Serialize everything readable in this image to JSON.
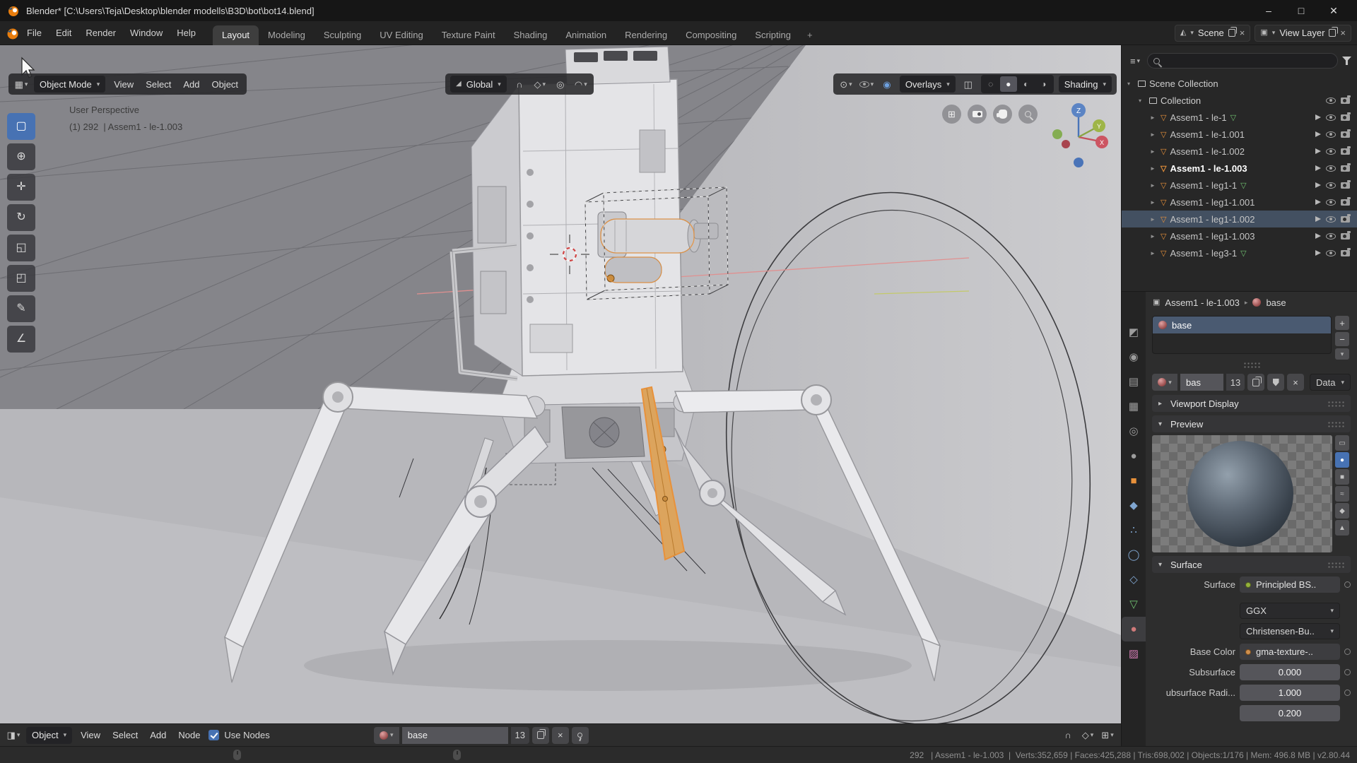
{
  "titlebar": {
    "title": "Blender* [C:\\Users\\Teja\\Desktop\\blender modells\\B3D\\bot\\bot14.blend]",
    "minimize": "–",
    "maximize": "□",
    "close": "✕"
  },
  "topbar": {
    "menus": [
      "File",
      "Edit",
      "Render",
      "Window",
      "Help"
    ],
    "tabs": [
      "Layout",
      "Modeling",
      "Sculpting",
      "UV Editing",
      "Texture Paint",
      "Shading",
      "Animation",
      "Rendering",
      "Compositing",
      "Scripting"
    ],
    "add_tab": "+",
    "scene_label": "Scene",
    "view_layer_label": "View Layer"
  },
  "viewport": {
    "mode": "Object Mode",
    "menu_view": "View",
    "menu_select": "Select",
    "menu_add": "Add",
    "menu_object": "Object",
    "orientation": "Global",
    "overlays_label": "Overlays",
    "shading_label": "Shading",
    "perspective_text": "User Perspective",
    "info_text": "(1) 292  | Assem1 - le-1.003",
    "gizmo": {
      "x": "X",
      "y": "Y",
      "z": "Z"
    }
  },
  "tools": [
    {
      "name": "select-box",
      "glyph": "▢"
    },
    {
      "name": "cursor",
      "glyph": "⊕"
    },
    {
      "name": "move",
      "glyph": "✛"
    },
    {
      "name": "rotate",
      "glyph": "↻"
    },
    {
      "name": "scale",
      "glyph": "◱"
    },
    {
      "name": "transform",
      "glyph": "◰"
    },
    {
      "name": "annotate",
      "glyph": "✎"
    },
    {
      "name": "measure",
      "glyph": "∠"
    }
  ],
  "outliner": {
    "scene_collection": "Scene Collection",
    "collection": "Collection",
    "rows": [
      {
        "name": "Assem1 - le-1"
      },
      {
        "name": "Assem1 - le-1.001"
      },
      {
        "name": "Assem1 - le-1.002"
      },
      {
        "name": "Assem1 - le-1.003"
      },
      {
        "name": "Assem1 - leg1-1"
      },
      {
        "name": "Assem1 - leg1-1.001"
      },
      {
        "name": "Assem1 - leg1-1.002"
      },
      {
        "name": "Assem1 - leg1-1.003"
      },
      {
        "name": "Assem1 - leg3-1"
      }
    ]
  },
  "properties": {
    "breadcrumb_object": "Assem1 - le-1.003",
    "breadcrumb_material": "base",
    "slot_name": "base",
    "block_name": "bas",
    "block_users": "13",
    "block_link": "Data",
    "section_viewport_display": "Viewport Display",
    "section_preview": "Preview",
    "section_surface": "Surface",
    "surface_label": "Surface",
    "surface_shader": "Principled BS..",
    "distribution": "GGX",
    "sss_method": "Christensen-Bu..",
    "base_color_label": "Base Color",
    "base_color_value": "gma-texture-..",
    "subsurface_label": "Subsurface",
    "subsurface_value": "0.000",
    "radius_label": "ubsurface Radi...",
    "radius_value1": "1.000",
    "radius_value2": "0.200"
  },
  "bottom": {
    "type_label": "Object",
    "menu_view": "View",
    "menu_select": "Select",
    "menu_add": "Add",
    "menu_node": "Node",
    "use_nodes": "Use Nodes",
    "material_name": "base",
    "material_users": "13"
  },
  "statusbar": {
    "stats": "292   | Assem1 - le-1.003  |  Verts:352,659 | Faces:425,288 | Tris:698,002 | Objects:1/176 | Mem: 496.8 MB | v2.80.44"
  },
  "icons": {
    "chevron": "▾",
    "expander_open": "▾",
    "expander_closed": "▸",
    "row_toggle": "►",
    "mesh": "▽",
    "plus": "+",
    "minus": "−",
    "close": "×",
    "overlay": "◉",
    "xray": "◫",
    "wire": "◌",
    "solid": "●",
    "material_shade": "◐",
    "rendered": "◑",
    "pivot": "⊙",
    "magnet": "∩",
    "prop_edit": "◎",
    "falloff": "◠",
    "orient": "◢",
    "snap_to": "◇",
    "editor_3d": "▦",
    "editor_list": "≡",
    "editor_shader": "◨",
    "grid": "⊞",
    "scene": "◭",
    "view_layer": "▣",
    "cube": "▣",
    "preview_types": [
      "▭",
      "●",
      "■",
      "≈",
      "◆",
      "▲"
    ]
  },
  "prop_tabs": [
    {
      "name": "active-tool",
      "glyph": "◩"
    },
    {
      "name": "render",
      "glyph": "◉"
    },
    {
      "name": "output",
      "glyph": "▤"
    },
    {
      "name": "view-layer",
      "glyph": "▦"
    },
    {
      "name": "scene",
      "glyph": "◎"
    },
    {
      "name": "world",
      "glyph": "●"
    },
    {
      "name": "object",
      "glyph": "■"
    },
    {
      "name": "modifiers",
      "glyph": "◆"
    },
    {
      "name": "particles",
      "glyph": "∴"
    },
    {
      "name": "physics",
      "glyph": "◯"
    },
    {
      "name": "constraints",
      "glyph": "◇"
    },
    {
      "name": "object-data",
      "glyph": "▽"
    },
    {
      "name": "material",
      "glyph": "●"
    },
    {
      "name": "texture",
      "glyph": "▨"
    }
  ]
}
